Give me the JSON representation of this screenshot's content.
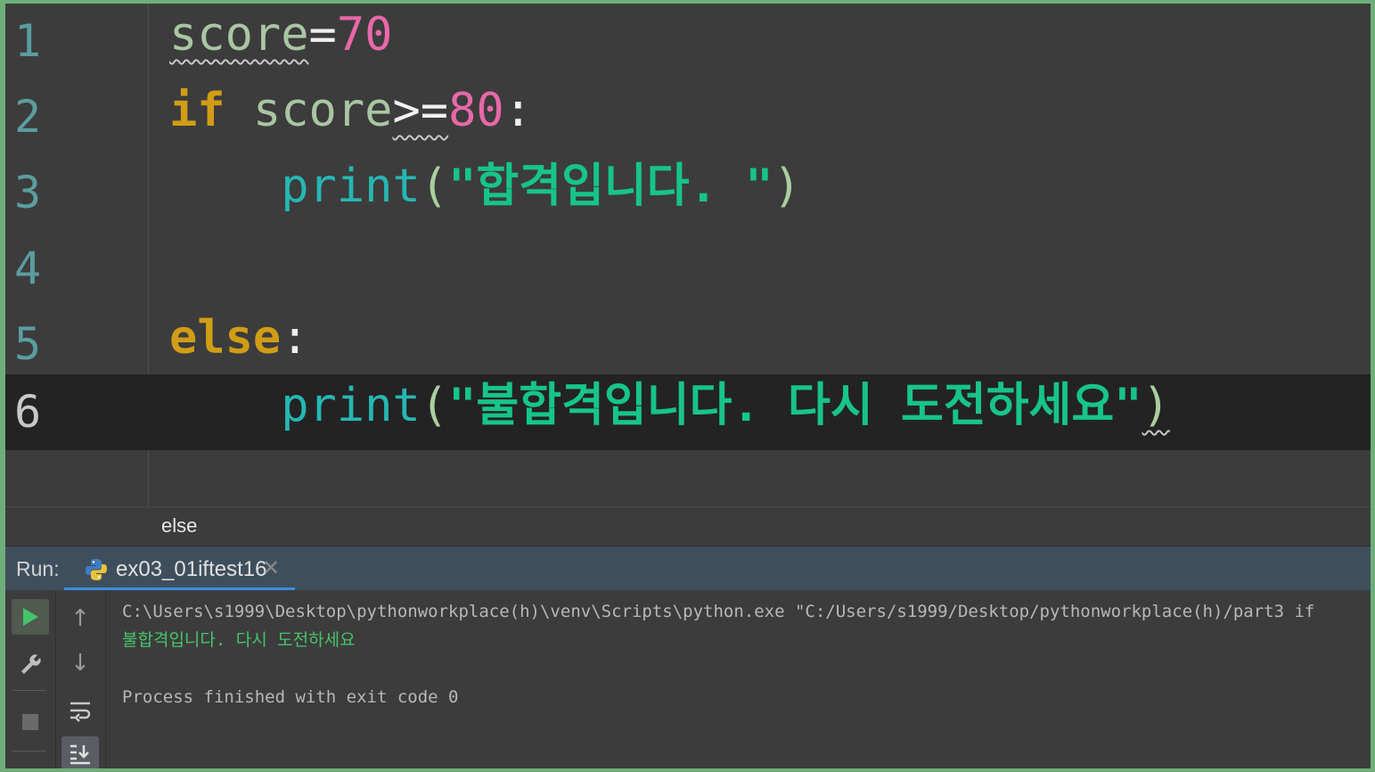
{
  "editor": {
    "lines": [
      {
        "num": "1",
        "tokens": [
          "score",
          "=",
          "70"
        ]
      },
      {
        "num": "2",
        "tokens": [
          "if",
          " ",
          "score",
          ">=",
          "80",
          ":"
        ]
      },
      {
        "num": "3",
        "tokens": [
          "    ",
          "print",
          "(",
          "\"합격입니다. \"",
          ")"
        ]
      },
      {
        "num": "4",
        "tokens": []
      },
      {
        "num": "5",
        "tokens": [
          "else",
          ":"
        ]
      },
      {
        "num": "6",
        "tokens": [
          "    ",
          "print",
          "(",
          "\"불합격입니다. 다시 도전하세요\"",
          ")"
        ]
      }
    ],
    "current_line": "6",
    "breadcrumb": "else"
  },
  "run": {
    "label": "Run:",
    "tab_label": "ex03_01iftest16",
    "tab_icon": "python-icon",
    "console": {
      "command": "C:\\Users\\s1999\\Desktop\\pythonworkplace(h)\\venv\\Scripts\\python.exe \"C:/Users/s1999/Desktop/pythonworkplace(h)/part3 if",
      "output": "불합격입니다. 다시 도전하세요",
      "exit": "Process finished with exit code 0"
    }
  },
  "colors": {
    "keyword": "#d19d16",
    "number": "#e868a9",
    "function": "#26b7b3",
    "string": "#17c48a",
    "tab_underline": "#3a8fe0",
    "run_green": "#46c46a"
  }
}
